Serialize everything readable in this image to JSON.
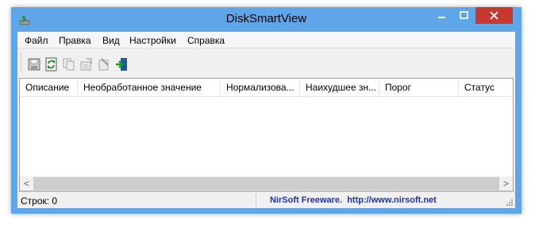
{
  "window": {
    "title": "DiskSmartView",
    "controls": {
      "minimize": "—",
      "maximize": "□",
      "close": "✕"
    }
  },
  "menu": [
    "Файл",
    "Правка",
    "Вид",
    "Настройки",
    "Справка"
  ],
  "toolbar": {
    "icons": [
      "save-icon",
      "refresh-icon",
      "copy-icon",
      "properties-icon",
      "html-report-icon",
      "exit-icon"
    ]
  },
  "table": {
    "columns": [
      "Описание",
      "Необработанное значение",
      "Нормализова...",
      "Наихудшее зн...",
      "Порог",
      "Статус"
    ],
    "rows": []
  },
  "scrollbar": {
    "left_arrow": "<",
    "right_arrow": ">"
  },
  "status": {
    "rows": "Строк: 0",
    "link": "NirSoft Freeware.  http://www.nirsoft.net"
  },
  "colors": {
    "titlebar": "#5ea6e8",
    "close_button": "#c7382f",
    "link": "#1c33b4"
  }
}
